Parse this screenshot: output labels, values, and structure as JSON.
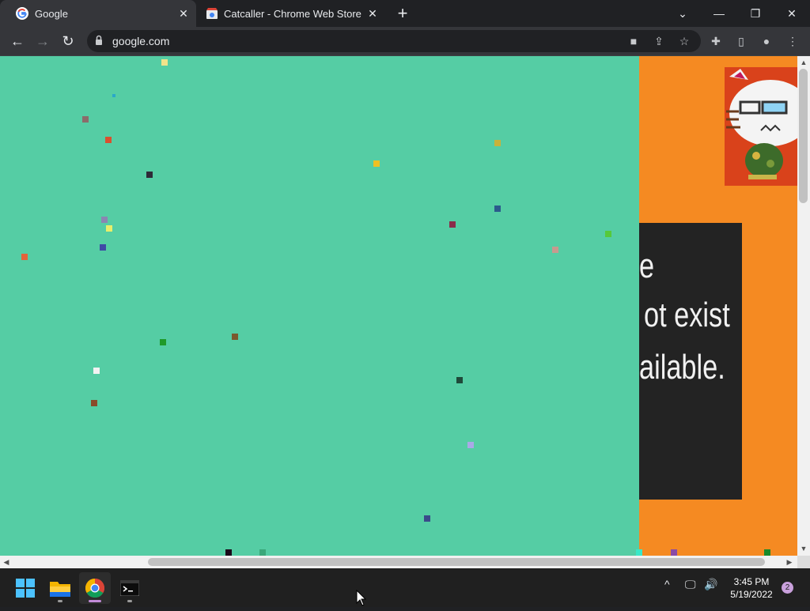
{
  "browser": {
    "tabs": [
      {
        "title": "Google",
        "favicon": "google-icon",
        "active": true
      },
      {
        "title": "Catcaller - Chrome Web Store",
        "favicon": "webstore-icon",
        "active": false
      }
    ],
    "url": "google.com",
    "toolbar_icons": [
      "camera-icon",
      "share-icon",
      "bookmark-star-icon",
      "extensions-icon",
      "side-panel-icon",
      "profile-icon",
      "menu-icon"
    ]
  },
  "page": {
    "error_lines": [
      "e",
      "ot exist",
      "ailable."
    ],
    "colors": {
      "background": "#55cda4",
      "orange_panel": "#f58a22",
      "dark_box": "#232323"
    }
  },
  "taskbar": {
    "apps": [
      "start-icon",
      "file-explorer-icon",
      "chrome-icon",
      "terminal-icon"
    ],
    "time": "3:45 PM",
    "date": "5/19/2022",
    "notification_count": "2"
  }
}
